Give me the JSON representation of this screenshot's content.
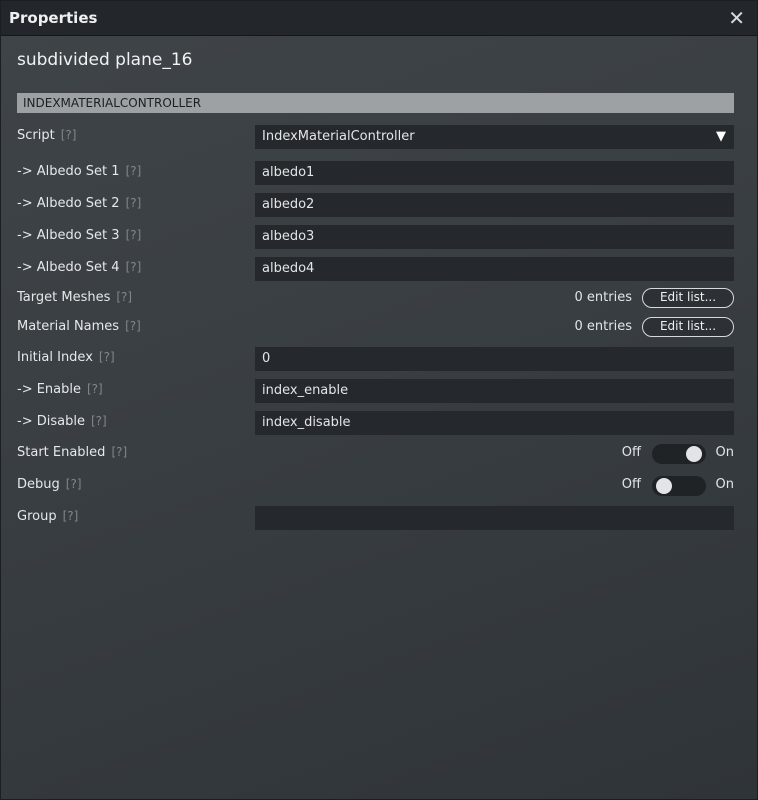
{
  "window": {
    "title": "Properties",
    "close_glyph": "✕"
  },
  "object_name": "subdivided plane_16",
  "section": "INDEXMATERIALCONTROLLER",
  "help_marker": "[?]",
  "script": {
    "label": "Script",
    "value": "IndexMaterialController",
    "arrow": "▼"
  },
  "albedo_sets": [
    {
      "label": "-> Albedo Set 1",
      "value": "albedo1"
    },
    {
      "label": "-> Albedo Set 2",
      "value": "albedo2"
    },
    {
      "label": "-> Albedo Set 3",
      "value": "albedo3"
    },
    {
      "label": "-> Albedo Set 4",
      "value": "albedo4"
    }
  ],
  "target_meshes": {
    "label": "Target Meshes",
    "entries": "0 entries",
    "button": "Edit list..."
  },
  "material_names": {
    "label": "Material Names",
    "entries": "0 entries",
    "button": "Edit list..."
  },
  "initial_index": {
    "label": "Initial Index",
    "value": "0"
  },
  "enable": {
    "label": "-> Enable",
    "value": "index_enable"
  },
  "disable": {
    "label": "-> Disable",
    "value": "index_disable"
  },
  "start_enabled": {
    "label": "Start Enabled",
    "off_label": "Off",
    "on_label": "On",
    "state": "on"
  },
  "debug": {
    "label": "Debug",
    "off_label": "Off",
    "on_label": "On",
    "state": "off"
  },
  "group": {
    "label": "Group",
    "value": ""
  },
  "colors": {
    "panel_bg": "#3c4145",
    "titlebar_bg": "#23272b",
    "field_bg": "#25292d",
    "section_header_bg": "#9da1a4"
  },
  "icons": {
    "close": "close-icon",
    "dropdown": "chevron-down-icon"
  }
}
